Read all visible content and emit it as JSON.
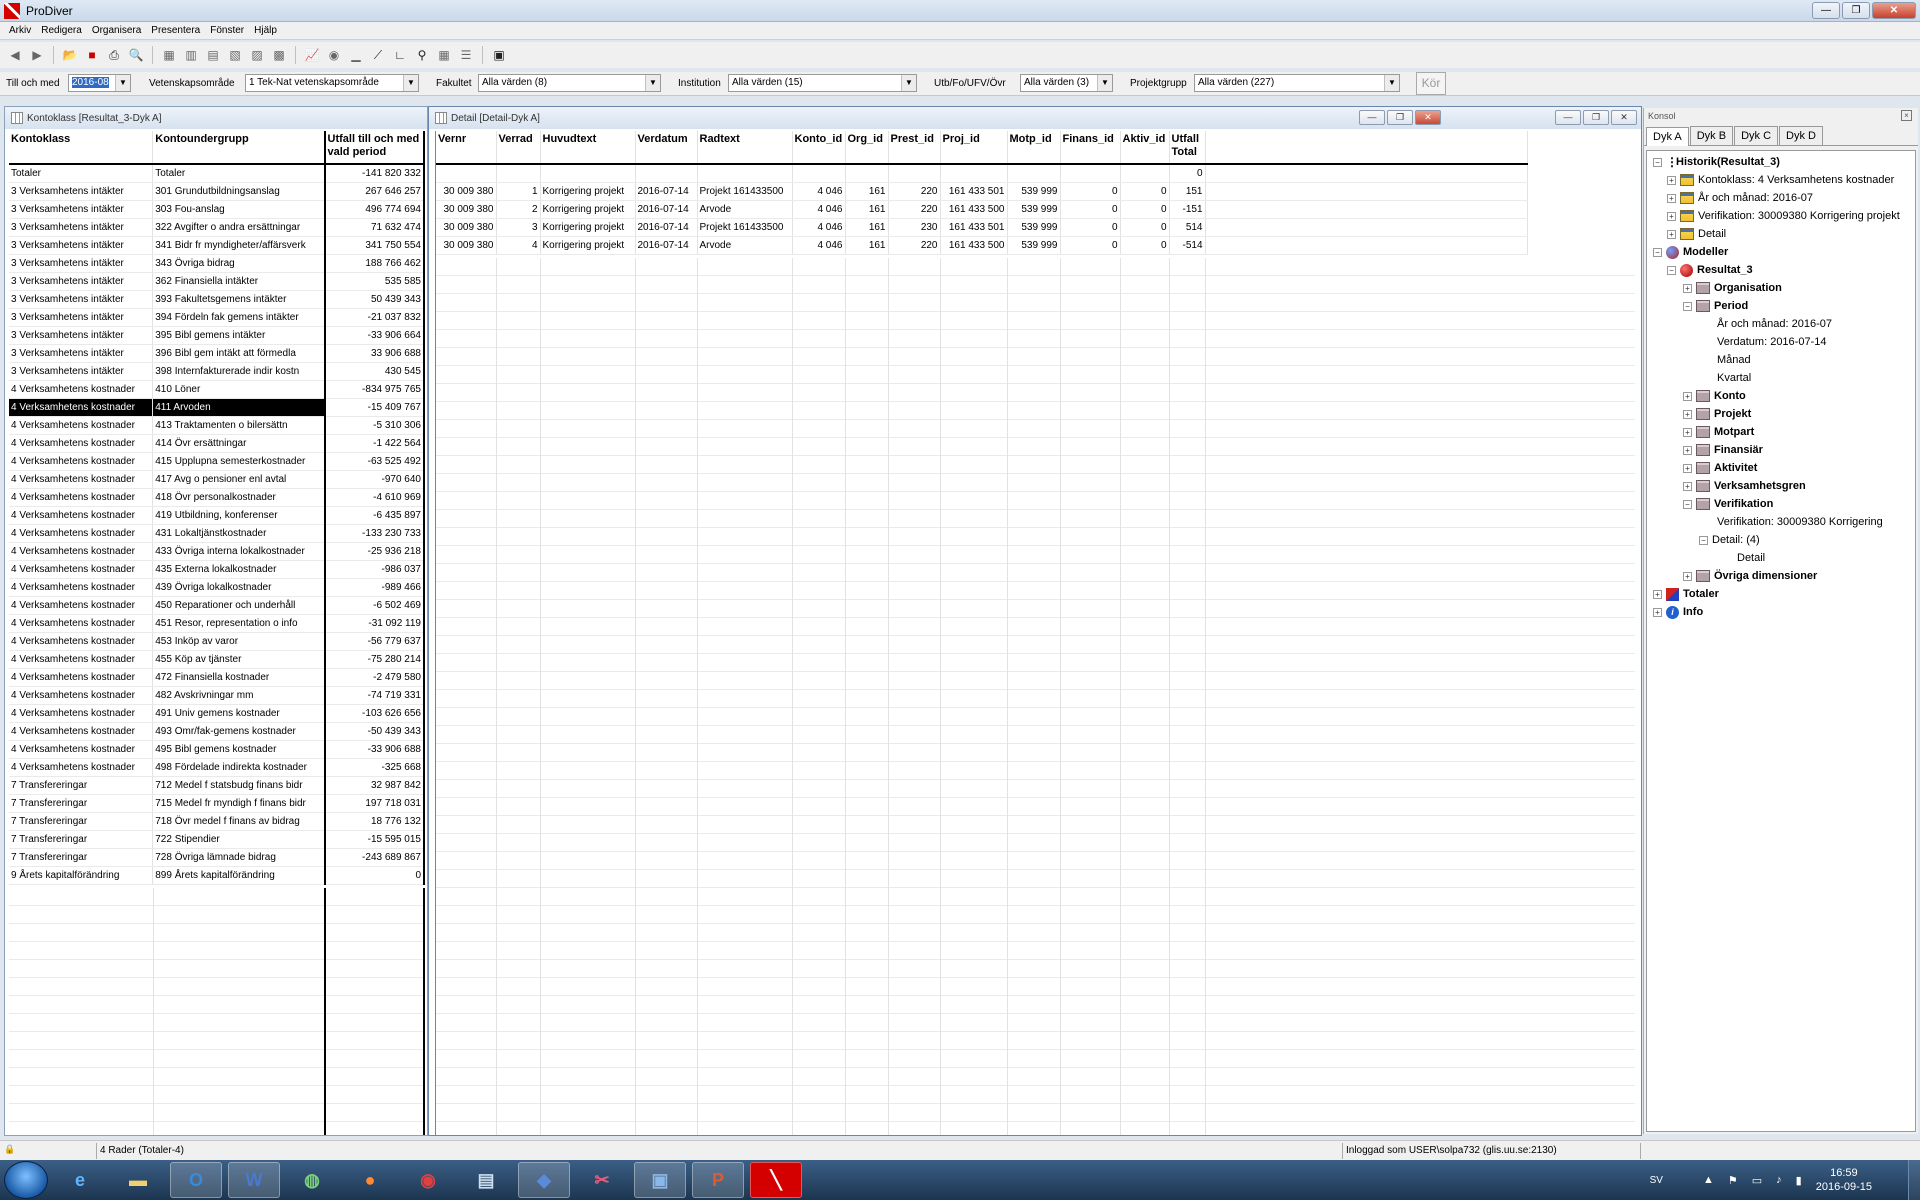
{
  "app": {
    "title": "ProDiver"
  },
  "menu": [
    "Arkiv",
    "Redigera",
    "Organisera",
    "Presentera",
    "Fönster",
    "Hjälp"
  ],
  "filters": {
    "till_och_med": {
      "label": "Till och med",
      "value": "2016-08"
    },
    "vetenskapsomrade": {
      "label": "Vetenskapsområde",
      "value": "1 Tek-Nat vetenskapsområde"
    },
    "fakultet": {
      "label": "Fakultet",
      "value": "Alla värden (8)"
    },
    "institution": {
      "label": "Institution",
      "value": "Alla värden (15)"
    },
    "utb": {
      "label": "Utb/Fo/UFV/Övr",
      "value": "Alla värden (3)"
    },
    "projektgrupp": {
      "label": "Projektgrupp",
      "value": "Alla värden (227)"
    },
    "run_label": "Kör"
  },
  "kontoklass": {
    "title": "Kontoklass [Resultat_3-Dyk A]",
    "columns": [
      "Kontoklass",
      "Kontoundergrupp",
      "Utfall till och med vald period"
    ],
    "rows": [
      [
        "Totaler",
        "Totaler",
        "-141 820 332"
      ],
      [
        "3 Verksamhetens intäkter",
        "301 Grundutbildningsanslag",
        "267 646 257"
      ],
      [
        "3 Verksamhetens intäkter",
        "303 Fou-anslag",
        "496 774 694"
      ],
      [
        "3 Verksamhetens intäkter",
        "322 Avgifter o andra ersättningar",
        "71 632 474"
      ],
      [
        "3 Verksamhetens intäkter",
        "341 Bidr fr myndigheter/affärsverk",
        "341 750 554"
      ],
      [
        "3 Verksamhetens intäkter",
        "343 Övriga bidrag",
        "188 766 462"
      ],
      [
        "3 Verksamhetens intäkter",
        "362 Finansiella intäkter",
        "535 585"
      ],
      [
        "3 Verksamhetens intäkter",
        "393 Fakultetsgemens intäkter",
        "50 439 343"
      ],
      [
        "3 Verksamhetens intäkter",
        "394 Fördeln fak gemens intäkter",
        "-21 037 832"
      ],
      [
        "3 Verksamhetens intäkter",
        "395 Bibl gemens intäkter",
        "-33 906 664"
      ],
      [
        "3 Verksamhetens intäkter",
        "396 Bibl gem intäkt att förmedla",
        "33 906 688"
      ],
      [
        "3 Verksamhetens intäkter",
        "398 Internfakturerade indir kostn",
        "430 545"
      ],
      [
        "4 Verksamhetens kostnader",
        "410 Löner",
        "-834 975 765"
      ],
      [
        "4 Verksamhetens kostnader",
        "411 Arvoden",
        "-15 409 767"
      ],
      [
        "4 Verksamhetens kostnader",
        "413 Traktamenten o bilersättn",
        "-5 310 306"
      ],
      [
        "4 Verksamhetens kostnader",
        "414 Övr ersättningar",
        "-1 422 564"
      ],
      [
        "4 Verksamhetens kostnader",
        "415 Upplupna semesterkostnader",
        "-63 525 492"
      ],
      [
        "4 Verksamhetens kostnader",
        "417 Avg o pensioner enl avtal",
        "-970 640"
      ],
      [
        "4 Verksamhetens kostnader",
        "418 Övr personalkostnader",
        "-4 610 969"
      ],
      [
        "4 Verksamhetens kostnader",
        "419 Utbildning, konferenser",
        "-6 435 897"
      ],
      [
        "4 Verksamhetens kostnader",
        "431 Lokaltjänstkostnader",
        "-133 230 733"
      ],
      [
        "4 Verksamhetens kostnader",
        "433 Övriga interna lokalkostnader",
        "-25 936 218"
      ],
      [
        "4 Verksamhetens kostnader",
        "435 Externa lokalkostnader",
        "-986 037"
      ],
      [
        "4 Verksamhetens kostnader",
        "439 Övriga lokalkostnader",
        "-989 466"
      ],
      [
        "4 Verksamhetens kostnader",
        "450 Reparationer och underhåll",
        "-6 502 469"
      ],
      [
        "4 Verksamhetens kostnader",
        "451 Resor, representation o info",
        "-31 092 119"
      ],
      [
        "4 Verksamhetens kostnader",
        "453 Inköp av varor",
        "-56 779 637"
      ],
      [
        "4 Verksamhetens kostnader",
        "455 Köp av tjänster",
        "-75 280 214"
      ],
      [
        "4 Verksamhetens kostnader",
        "472 Finansiella kostnader",
        "-2 479 580"
      ],
      [
        "4 Verksamhetens kostnader",
        "482 Avskrivningar mm",
        "-74 719 331"
      ],
      [
        "4 Verksamhetens kostnader",
        "491 Univ gemens kostnader",
        "-103 626 656"
      ],
      [
        "4 Verksamhetens kostnader",
        "493 Omr/fak-gemens kostnader",
        "-50 439 343"
      ],
      [
        "4 Verksamhetens kostnader",
        "495 Bibl gemens kostnader",
        "-33 906 688"
      ],
      [
        "4 Verksamhetens kostnader",
        "498 Fördelade indirekta kostnader",
        "-325 668"
      ],
      [
        "7 Transfereringar",
        "712 Medel f statsbudg finans bidr",
        "32 987 842"
      ],
      [
        "7 Transfereringar",
        "715 Medel fr myndigh f finans bidr",
        "197 718 031"
      ],
      [
        "7 Transfereringar",
        "718 Övr medel f finans av bidrag",
        "18 776 132"
      ],
      [
        "7 Transfereringar",
        "722 Stipendier",
        "-15 595 015"
      ],
      [
        "7 Transfereringar",
        "728 Övriga lämnade bidrag",
        "-243 689 867"
      ],
      [
        "9 Årets kapitalförändring",
        "899 Årets kapitalförändring",
        "0"
      ]
    ],
    "selected_row": 13
  },
  "detail": {
    "title": "Detail [Detail-Dyk A]",
    "columns": [
      "Vernr",
      "Verrad",
      "Huvudtext",
      "Verdatum",
      "Radtext",
      "Konto_id",
      "Org_id",
      "Prest_id",
      "Proj_id",
      "Motp_id",
      "Finans_id",
      "Aktiv_id",
      "Utfall Total"
    ],
    "total_row": [
      "",
      "",
      "",
      "",
      "",
      "",
      "",
      "",
      "",
      "",
      "",
      "",
      "0"
    ],
    "rows": [
      [
        "30 009 380",
        "1",
        "Korrigering projekt",
        "2016-07-14",
        "Projekt 161433500",
        "4 046",
        "161",
        "220",
        "161 433 501",
        "539 999",
        "0",
        "0",
        "151"
      ],
      [
        "30 009 380",
        "2",
        "Korrigering projekt",
        "2016-07-14",
        "Arvode",
        "4 046",
        "161",
        "220",
        "161 433 500",
        "539 999",
        "0",
        "0",
        "-151"
      ],
      [
        "30 009 380",
        "3",
        "Korrigering projekt",
        "2016-07-14",
        "Projekt 161433500",
        "4 046",
        "161",
        "230",
        "161 433 501",
        "539 999",
        "0",
        "0",
        "514"
      ],
      [
        "30 009 380",
        "4",
        "Korrigering projekt",
        "2016-07-14",
        "Arvode",
        "4 046",
        "161",
        "220",
        "161 433 500",
        "539 999",
        "0",
        "0",
        "-514"
      ]
    ]
  },
  "console": {
    "title": "Konsol",
    "tabs": [
      "Dyk A",
      "Dyk B",
      "Dyk C",
      "Dyk D"
    ],
    "tree": [
      {
        "label": "Historik(Resultat_3)",
        "bold": true,
        "icon": "history-icon"
      },
      {
        "label": "Kontoklass: 4 Verksamhetens kostnader",
        "icon": "table-icon"
      },
      {
        "label": "År och månad: 2016-07",
        "icon": "table-icon"
      },
      {
        "label": "Verifikation: 30009380 Korrigering projekt",
        "icon": "table-icon"
      },
      {
        "label": "Detail",
        "icon": "table-icon"
      },
      {
        "label": "Modeller",
        "bold": true,
        "icon": "models-icon"
      },
      {
        "label": "Resultat_3",
        "bold": true,
        "icon": "model-ball-icon"
      },
      {
        "label": "Organisation",
        "bold": true,
        "icon": "folder-icon"
      },
      {
        "label": "Period",
        "bold": true,
        "icon": "folder-icon"
      },
      {
        "label": "År och månad: 2016-07"
      },
      {
        "label": "Verdatum: 2016-07-14"
      },
      {
        "label": "Månad"
      },
      {
        "label": "Kvartal"
      },
      {
        "label": "Konto",
        "bold": true,
        "icon": "folder-icon"
      },
      {
        "label": "Projekt",
        "bold": true,
        "icon": "folder-icon"
      },
      {
        "label": "Motpart",
        "bold": true,
        "icon": "folder-icon"
      },
      {
        "label": "Finansiär",
        "bold": true,
        "icon": "folder-icon"
      },
      {
        "label": "Aktivitet",
        "bold": true,
        "icon": "folder-icon"
      },
      {
        "label": "Verksamhetsgren",
        "bold": true,
        "icon": "folder-icon"
      },
      {
        "label": "Verifikation",
        "bold": true,
        "icon": "folder-icon"
      },
      {
        "label": "Verifikation: 30009380 Korrigering"
      },
      {
        "label": "Detail: (4)"
      },
      {
        "label": "Detail"
      },
      {
        "label": "Övriga dimensioner",
        "bold": true,
        "icon": "folder-icon"
      },
      {
        "label": "Totaler",
        "bold": true,
        "icon": "totals-icon"
      },
      {
        "label": "Info",
        "bold": true,
        "icon": "info-icon"
      }
    ]
  },
  "status": {
    "rows": "4 Rader (Totaler-4)",
    "user": "Inloggad som USER\\solpa732 (glis.uu.se:2130)"
  },
  "taskbar": {
    "lang": "SV",
    "time": "16:59",
    "date": "2016-09-15"
  }
}
